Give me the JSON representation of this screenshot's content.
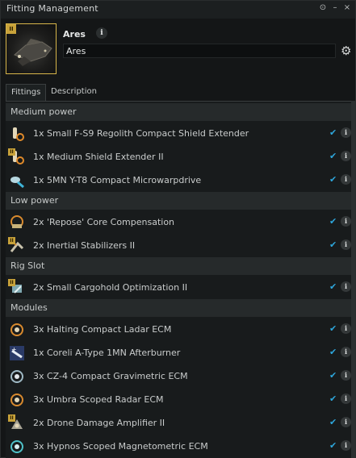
{
  "window": {
    "title": "Fitting Management"
  },
  "ship": {
    "name": "Ares",
    "name_input_value": "Ares"
  },
  "tabs": [
    {
      "label": "Fittings"
    },
    {
      "label": "Description"
    }
  ],
  "sections": [
    {
      "title": "Medium power"
    },
    {
      "title": "Low power"
    },
    {
      "title": "Rig Slot"
    },
    {
      "title": "Modules"
    }
  ],
  "medium_power": [
    {
      "label": "1x Small F-S9 Regolith Compact Shield Extender",
      "icon": "shield-extender-icon"
    },
    {
      "label": "1x Medium Shield Extender II",
      "icon": "shield-extender-icon"
    },
    {
      "label": "1x 5MN Y-T8 Compact Microwarpdrive",
      "icon": "microwarpdrive-icon"
    }
  ],
  "low_power": [
    {
      "label": "2x 'Repose' Core Compensation",
      "icon": "core-compensation-icon"
    },
    {
      "label": "2x Inertial Stabilizers II",
      "icon": "inertial-stabilizer-icon"
    }
  ],
  "rig_slot": [
    {
      "label": "2x Small Cargohold Optimization II",
      "icon": "cargohold-rig-icon"
    }
  ],
  "modules": [
    {
      "label": "3x Halting Compact Ladar ECM",
      "icon": "ecm-icon"
    },
    {
      "label": "1x Coreli A-Type 1MN Afterburner",
      "icon": "afterburner-icon"
    },
    {
      "label": "3x CZ-4 Compact Gravimetric ECM",
      "icon": "ecm-icon"
    },
    {
      "label": "3x Umbra Scoped Radar ECM",
      "icon": "ecm-icon"
    },
    {
      "label": "2x Drone Damage Amplifier II",
      "icon": "drone-damage-amplifier-icon"
    },
    {
      "label": "3x Hypnos Scoped Magnetometric ECM",
      "icon": "ecm-icon"
    }
  ],
  "colors": {
    "check": "#2ea7dc",
    "tech2_badge": "#c8a23a"
  }
}
